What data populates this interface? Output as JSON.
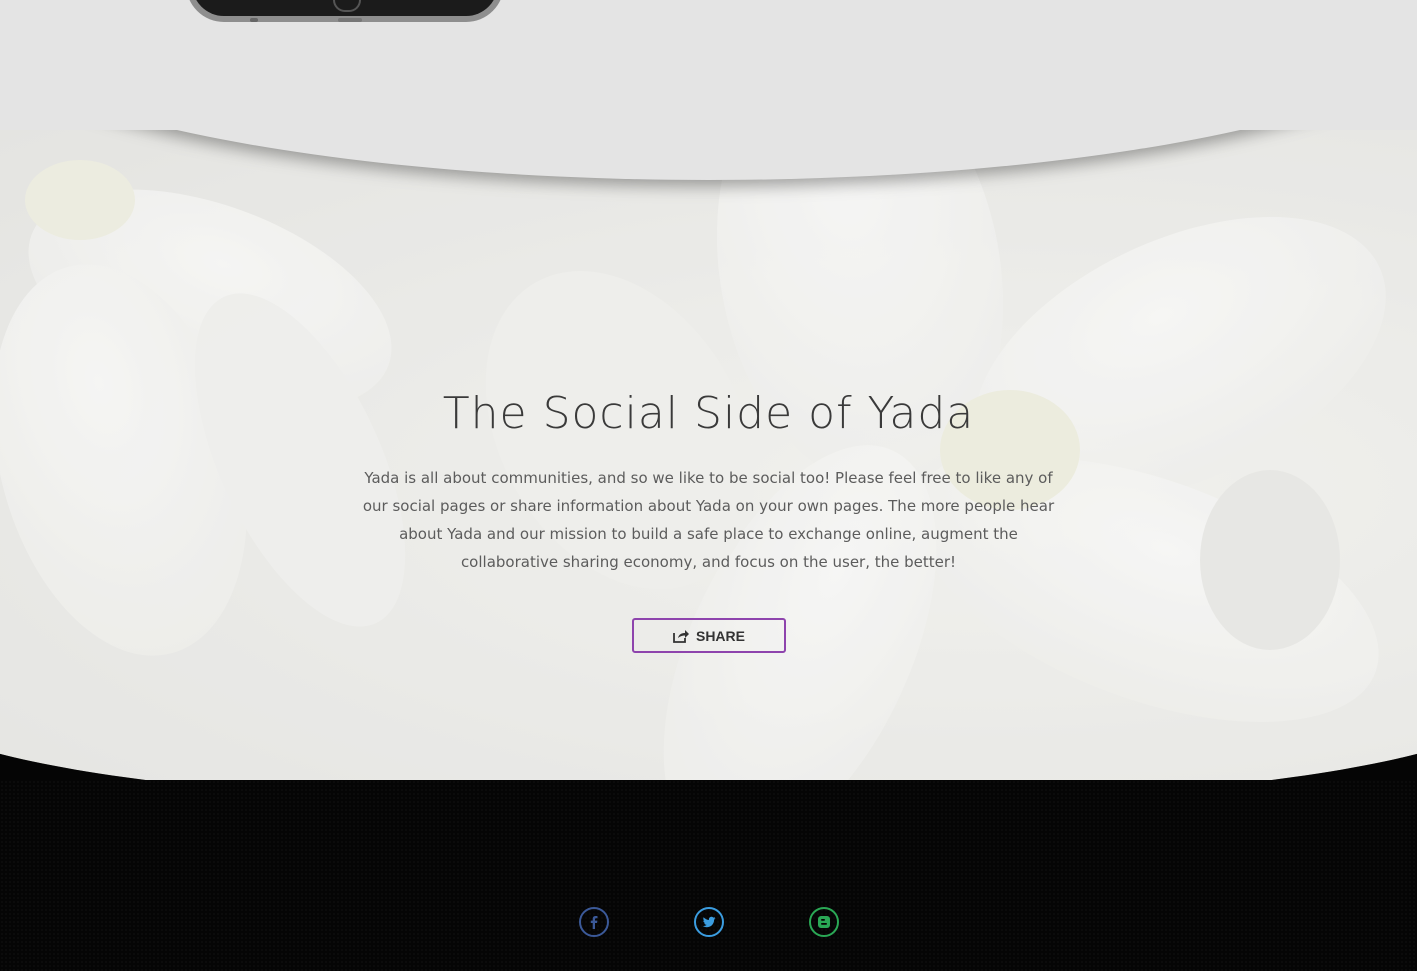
{
  "social": {
    "title": "The Social Side of Yada",
    "body": "Yada is all about communities, and so we like to be social too! Please feel free to like any of our social pages or share information about Yada on your own pages. The more people hear about Yada and our mission to build a safe place to exchange online, augment the collaborative sharing economy, and focus on the user, the better!",
    "share_label": "SHARE",
    "share_icon": "share-icon",
    "accent": "#8e44ad"
  },
  "footer": {
    "icons": [
      {
        "name": "facebook-icon",
        "color": "#3b5998"
      },
      {
        "name": "twitter-icon",
        "color": "#3b9de0"
      },
      {
        "name": "blogger-icon",
        "color": "#2aa855"
      }
    ]
  }
}
